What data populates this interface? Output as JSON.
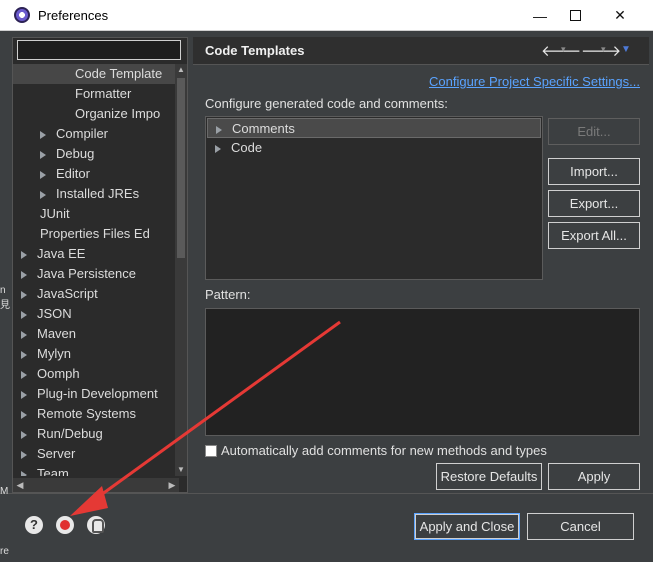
{
  "window": {
    "title": "Preferences",
    "min_glyph": "—",
    "close_glyph": "✕"
  },
  "left": {
    "filter_value": "",
    "tree": [
      {
        "label": "Code Template",
        "level": 3,
        "arrow": false,
        "selected": true
      },
      {
        "label": "Formatter",
        "level": 3,
        "arrow": false
      },
      {
        "label": "Organize Impo",
        "level": 3,
        "arrow": false
      },
      {
        "label": "Compiler",
        "level": 2,
        "arrow": true
      },
      {
        "label": "Debug",
        "level": 2,
        "arrow": true
      },
      {
        "label": "Editor",
        "level": 2,
        "arrow": true
      },
      {
        "label": "Installed JREs",
        "level": 2,
        "arrow": true
      },
      {
        "label": "JUnit",
        "level": 2,
        "arrow": false
      },
      {
        "label": "Properties Files Ed",
        "level": 2,
        "arrow": false
      },
      {
        "label": "Java EE",
        "level": 1,
        "arrow": true
      },
      {
        "label": "Java Persistence",
        "level": 1,
        "arrow": true
      },
      {
        "label": "JavaScript",
        "level": 1,
        "arrow": true
      },
      {
        "label": "JSON",
        "level": 1,
        "arrow": true
      },
      {
        "label": "Maven",
        "level": 1,
        "arrow": true
      },
      {
        "label": "Mylyn",
        "level": 1,
        "arrow": true
      },
      {
        "label": "Oomph",
        "level": 1,
        "arrow": true
      },
      {
        "label": "Plug-in Development",
        "level": 1,
        "arrow": true
      },
      {
        "label": "Remote Systems",
        "level": 1,
        "arrow": true
      },
      {
        "label": "Run/Debug",
        "level": 1,
        "arrow": true
      },
      {
        "label": "Server",
        "level": 1,
        "arrow": true
      },
      {
        "label": "Team",
        "level": 1,
        "arrow": true
      }
    ]
  },
  "page": {
    "title": "Code Templates",
    "nav": {
      "back": "🡐",
      "forward": "🡒",
      "dropdown": "▾",
      "menu": "▼"
    },
    "project_link": "Configure Project Specific Settings...",
    "configure_label": "Configure generated code and comments:",
    "templates": [
      {
        "label": "Comments",
        "selected": true
      },
      {
        "label": "Code",
        "selected": false
      }
    ],
    "buttons": {
      "edit": "Edit...",
      "import": "Import...",
      "export": "Export...",
      "export_all": "Export All..."
    },
    "pattern_label": "Pattern:",
    "checkbox_label": "Automatically add comments for new methods and types",
    "checkbox_checked": false,
    "restore_defaults": "Restore Defaults",
    "apply": "Apply"
  },
  "footer": {
    "help_glyph": "?",
    "apply_close": "Apply and Close",
    "cancel": "Cancel"
  },
  "colors": {
    "background": "#3c3f41",
    "link": "#5aa3ff",
    "annotation_arrow": "#e53935"
  },
  "edge_text": {
    "a": "n",
    "b": "見",
    "c": "M",
    "d": "re"
  }
}
